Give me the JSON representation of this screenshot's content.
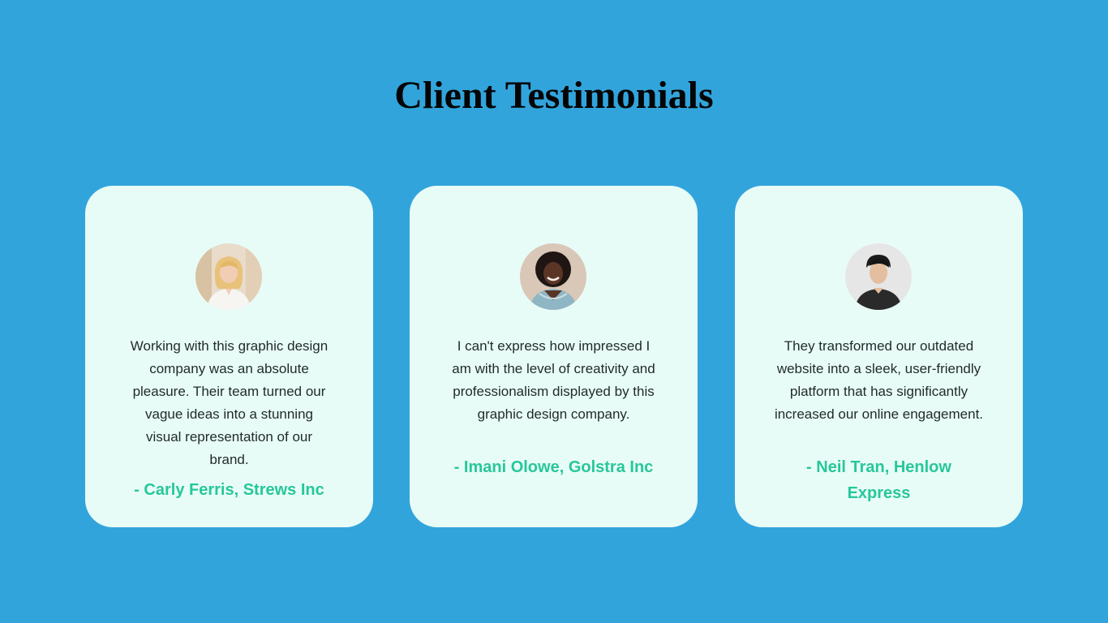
{
  "page": {
    "title": "Client Testimonials"
  },
  "colors": {
    "background": "#32a4dc",
    "card": "#e8fcf7",
    "author": "#27c79a",
    "title": "#050505"
  },
  "testimonials": [
    {
      "avatar_icon": "woman-blonde-avatar",
      "quote": "Working with this graphic design company was an absolute pleasure. Their team turned our vague ideas into a stunning visual representation of our brand.",
      "author": "- Carly Ferris, Strews Inc"
    },
    {
      "avatar_icon": "woman-curly-hair-avatar",
      "quote": "I can't express how impressed I am with the level of creativity and professionalism displayed by this graphic design company.",
      "author": "- Imani Olowe, Golstra Inc"
    },
    {
      "avatar_icon": "man-dark-hair-avatar",
      "quote": "They transformed our outdated website into a sleek, user-friendly platform that has significantly increased our online engagement.",
      "author": "- Neil Tran, Henlow Express"
    }
  ]
}
